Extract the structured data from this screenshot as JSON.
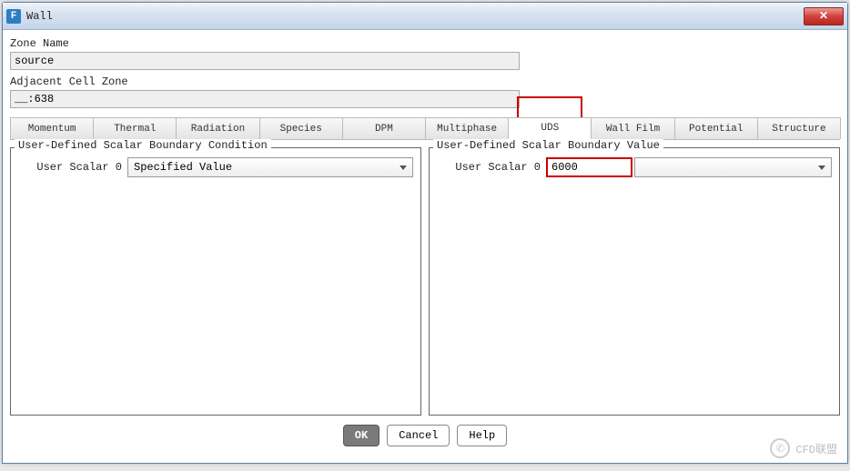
{
  "window": {
    "title": "Wall"
  },
  "fields": {
    "zone_name_label": "Zone Name",
    "zone_name_value": "source",
    "adjacent_label": "Adjacent Cell Zone",
    "adjacent_value": "__:638"
  },
  "tabs": [
    "Momentum",
    "Thermal",
    "Radiation",
    "Species",
    "DPM",
    "Multiphase",
    "UDS",
    "Wall Film",
    "Potential",
    "Structure"
  ],
  "active_tab": "UDS",
  "left_panel": {
    "title": "User-Defined Scalar Boundary Condition",
    "row_label": "User Scalar 0",
    "select_value": "Specified Value"
  },
  "right_panel": {
    "title": "User-Defined Scalar Boundary Value",
    "row_label": "User Scalar 0",
    "input_value": "6000"
  },
  "buttons": {
    "ok": "OK",
    "cancel": "Cancel",
    "help": "Help"
  },
  "watermark": "CFD联盟"
}
